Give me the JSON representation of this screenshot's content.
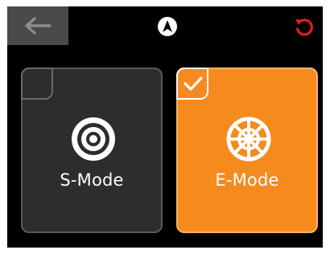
{
  "topbar": {
    "back_icon": "arrow-left-icon",
    "center_icon": "navigation-icon",
    "reset_icon": "reset-icon",
    "reset_color": "#e02020"
  },
  "modes": [
    {
      "label": "S-Mode",
      "icon": "target-icon",
      "selected": false
    },
    {
      "label": "E-Mode",
      "icon": "wheel-icon",
      "selected": true
    }
  ],
  "colors": {
    "accent": "#f58a1f",
    "card_dark": "#2d2d2f"
  }
}
